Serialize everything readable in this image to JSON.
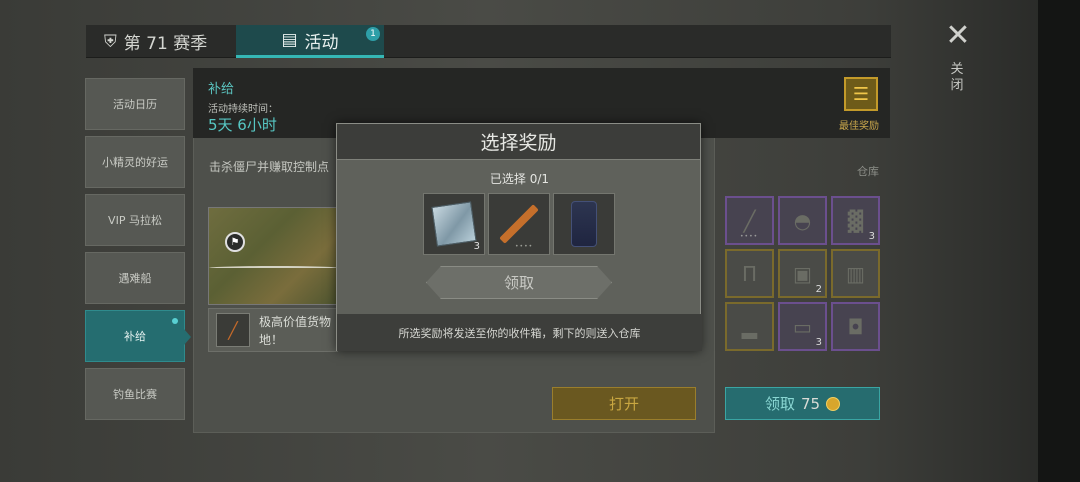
{
  "tabs": {
    "season_label": "第 71 赛季",
    "activity_label": "活动",
    "activity_badge": "1"
  },
  "sidebar": {
    "items": [
      {
        "label": "活动日历"
      },
      {
        "label": "小精灵的好运"
      },
      {
        "label": "VIP 马拉松"
      },
      {
        "label": "遇难船"
      },
      {
        "label": "补给"
      },
      {
        "label": "钓鱼比赛"
      }
    ]
  },
  "event": {
    "title": "补给",
    "duration_label": "活动持续时间：",
    "duration_value": "5天 6小时",
    "objective": "击杀僵尸并赚取控制点",
    "desc": "极高价值货物",
    "desc_line2": "地！"
  },
  "best_reward": {
    "label": "最佳奖励"
  },
  "storage": {
    "label": "仓库",
    "slots": [
      {
        "icon": "rifle-icon",
        "count": "",
        "rarity": "purple"
      },
      {
        "icon": "helmet-icon",
        "count": "",
        "rarity": "purple"
      },
      {
        "icon": "ore-icon",
        "count": "3",
        "rarity": "purple"
      },
      {
        "icon": "pants-icon",
        "count": "",
        "rarity": "gold"
      },
      {
        "icon": "food-bag-icon",
        "count": "2",
        "rarity": "gold"
      },
      {
        "icon": "backpack-icon",
        "count": "",
        "rarity": "gold"
      },
      {
        "icon": "boots-icon",
        "count": "",
        "rarity": "gold"
      },
      {
        "icon": "medkit-icon",
        "count": "3",
        "rarity": "purple"
      },
      {
        "icon": "armor-icon",
        "count": "",
        "rarity": "purple"
      }
    ]
  },
  "buttons": {
    "open_label": "打开",
    "claim_label": "领取",
    "claim_price": "75"
  },
  "close": {
    "label": "关闭"
  },
  "modal": {
    "title": "选择奖励",
    "selected": "已选择 0/1",
    "rewards": [
      {
        "icon": "metal-plate-icon",
        "count": "3"
      },
      {
        "icon": "rifle-icon",
        "count": ""
      },
      {
        "icon": "pants-icon",
        "count": ""
      }
    ],
    "receive_label": "领取",
    "footer": "所选奖励将发送至你的收件箱，剩下的则送入仓库"
  }
}
